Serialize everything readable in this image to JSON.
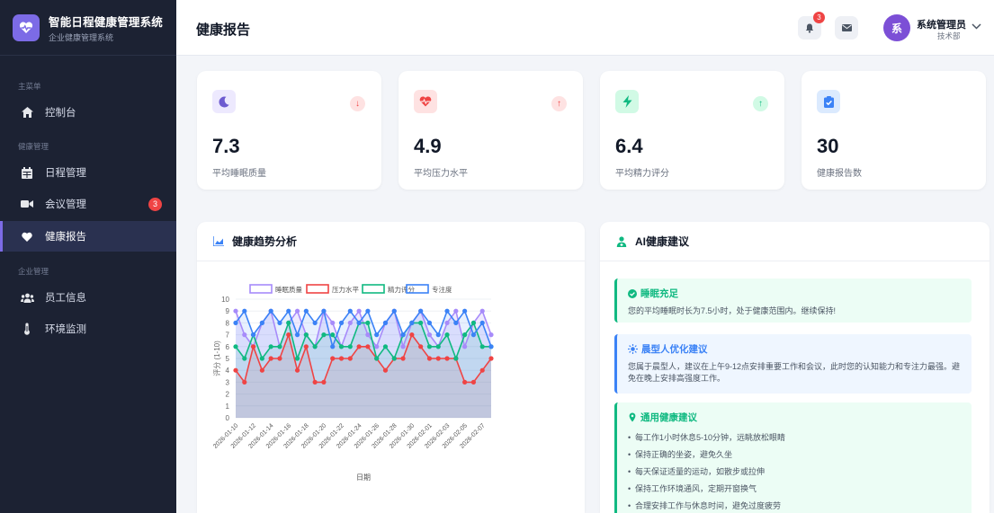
{
  "app": {
    "title": "智能日程健康管理系统",
    "subtitle": "企业健康管理系统"
  },
  "sidebar": {
    "sections": [
      {
        "label": "主菜单"
      },
      {
        "label": "健康管理"
      },
      {
        "label": "企业管理"
      }
    ],
    "items": [
      {
        "label": "控制台",
        "icon": "home-icon"
      },
      {
        "label": "日程管理",
        "icon": "calendar-icon"
      },
      {
        "label": "会议管理",
        "icon": "video-icon",
        "badge": "3"
      },
      {
        "label": "健康报告",
        "icon": "heart-icon",
        "active": true
      },
      {
        "label": "员工信息",
        "icon": "users-icon"
      },
      {
        "label": "环境监测",
        "icon": "thermometer-icon"
      }
    ]
  },
  "header": {
    "title": "健康报告",
    "notification_count": "3",
    "user": {
      "avatar_text": "系",
      "name": "系统管理员",
      "dept": "技术部"
    }
  },
  "stats": [
    {
      "value": "7.3",
      "label": "平均睡眠质量",
      "icon": "moon-icon",
      "trend": "down",
      "color": "#7c6be6"
    },
    {
      "value": "4.9",
      "label": "平均压力水平",
      "icon": "heartbeat-icon",
      "trend": "up",
      "color": "#ef4444"
    },
    {
      "value": "6.4",
      "label": "平均精力评分",
      "icon": "bolt-icon",
      "trend": "up",
      "color": "#10b981"
    },
    {
      "value": "30",
      "label": "健康报告数",
      "icon": "clipboard-check-icon",
      "trend": "",
      "color": "#3b82f6"
    }
  ],
  "trend_panel": {
    "title": "健康趋势分析"
  },
  "advice_panel": {
    "title": "AI健康建议",
    "cards": [
      {
        "title": "睡眠充足",
        "text": "您的平均睡眠时长为7.5小时，处于健康范围内。继续保持!",
        "color": "#10b981"
      },
      {
        "title": "晨型人优化建议",
        "text": "您属于晨型人，建议在上午9-12点安排重要工作和会议，此时您的认知能力和专注力最强。避免在晚上安排高强度工作。",
        "color": "#3b82f6"
      },
      {
        "title": "通用健康建议",
        "color": "#10b981",
        "list": [
          "每工作1小时休息5-10分钟，远眺放松眼睛",
          "保持正确的坐姿，避免久坐",
          "每天保证适量的运动，如散步或拉伸",
          "保持工作环境通风，定期开窗换气",
          "合理安排工作与休息时间，避免过度疲劳"
        ]
      }
    ]
  },
  "chart_data": {
    "type": "line",
    "xlabel": "日期",
    "ylabel": "评分 (1-10)",
    "ylim": [
      0,
      10
    ],
    "yticks": [
      0,
      1,
      2,
      3,
      4,
      5,
      6,
      7,
      8,
      9,
      10
    ],
    "x_tick_labels": [
      "2026-01-10",
      "2026-01-12",
      "2026-01-14",
      "2026-01-16",
      "2026-01-18",
      "2026-01-20",
      "2026-01-22",
      "2026-01-24",
      "2026-01-26",
      "2026-01-28",
      "2026-01-30",
      "2026-02-01",
      "2026-02-03",
      "2026-02-05",
      "2026-02-07"
    ],
    "x": [
      "2026-01-10",
      "2026-01-11",
      "2026-01-12",
      "2026-01-13",
      "2026-01-14",
      "2026-01-15",
      "2026-01-16",
      "2026-01-17",
      "2026-01-18",
      "2026-01-19",
      "2026-01-20",
      "2026-01-21",
      "2026-01-22",
      "2026-01-23",
      "2026-01-24",
      "2026-01-25",
      "2026-01-26",
      "2026-01-27",
      "2026-01-28",
      "2026-01-29",
      "2026-01-30",
      "2026-01-31",
      "2026-02-01",
      "2026-02-02",
      "2026-02-03",
      "2026-02-04",
      "2026-02-05",
      "2026-02-06",
      "2026-02-07",
      "2026-02-08"
    ],
    "legend_position": "top",
    "series": [
      {
        "name": "睡眠质量",
        "color": "#a78bfa",
        "fill": "rgba(167,139,250,0.18)",
        "values": [
          9,
          7,
          6,
          8,
          9,
          6,
          8,
          9,
          7,
          6,
          9,
          8,
          6,
          8,
          9,
          7,
          6,
          8,
          9,
          6,
          8,
          9,
          7,
          6,
          8,
          9,
          6,
          8,
          9,
          7
        ]
      },
      {
        "name": "压力水平",
        "color": "#ef4444",
        "fill": "rgba(239,68,68,0.12)",
        "values": [
          4,
          3,
          6,
          4,
          5,
          5,
          7,
          4,
          6,
          3,
          3,
          5,
          5,
          5,
          6,
          6,
          5,
          4,
          5,
          5,
          7,
          6,
          5,
          5,
          5,
          5,
          3,
          3,
          4,
          5
        ]
      },
      {
        "name": "精力评分",
        "color": "#10b981",
        "fill": "rgba(16,185,129,0.12)",
        "values": [
          6,
          5,
          7,
          5,
          6,
          6,
          8,
          5,
          7,
          6,
          7,
          7,
          6,
          6,
          8,
          8,
          5,
          6,
          5,
          7,
          8,
          8,
          6,
          6,
          7,
          5,
          7,
          8,
          6,
          6
        ]
      },
      {
        "name": "专注度",
        "color": "#3b82f6",
        "fill": "rgba(59,130,246,0.12)",
        "values": [
          8,
          9,
          7,
          8,
          9,
          8,
          9,
          7,
          9,
          8,
          9,
          6,
          8,
          9,
          8,
          9,
          7,
          8,
          9,
          7,
          8,
          9,
          8,
          7,
          9,
          8,
          9,
          7,
          8,
          6
        ]
      }
    ]
  }
}
